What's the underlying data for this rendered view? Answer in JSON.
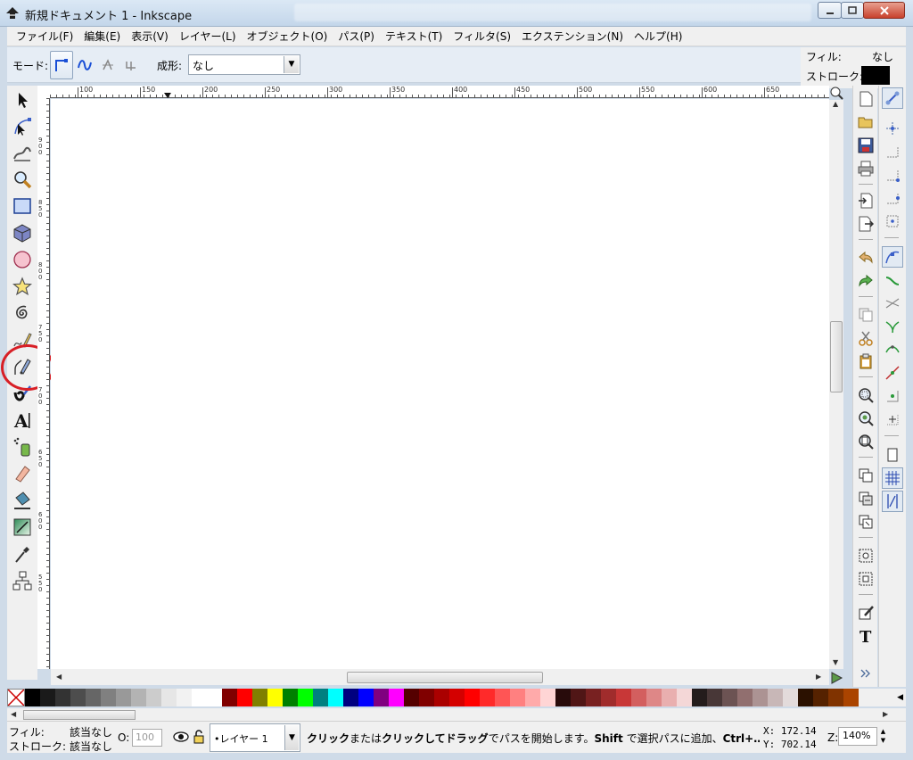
{
  "window": {
    "title": "新規ドキュメント 1 - Inkscape"
  },
  "menu": [
    "ファイル(F)",
    "編集(E)",
    "表示(V)",
    "レイヤー(L)",
    "オブジェクト(O)",
    "パス(P)",
    "テキスト(T)",
    "フィルタ(S)",
    "エクステンション(N)",
    "ヘルプ(H)"
  ],
  "tool_controls": {
    "mode_label": "モード:",
    "shape_label": "成形:",
    "shape_value": "なし"
  },
  "fill_stroke": {
    "fill_label": "フィル:",
    "fill_value": "なし",
    "stroke_label": "ストローク:",
    "stroke_color": "#000000"
  },
  "ruler": {
    "top_labels": [
      "100",
      "150",
      "200",
      "250",
      "300",
      "350",
      "400",
      "450",
      "500",
      "550",
      "600",
      "650"
    ],
    "left_labels": [
      "900",
      "850",
      "800",
      "750",
      "700",
      "650",
      "600",
      "550"
    ]
  },
  "palette": [
    "#000000",
    "#1a1a1a",
    "#333333",
    "#4d4d4d",
    "#666666",
    "#808080",
    "#999999",
    "#b3b3b3",
    "#cccccc",
    "#e6e6e6",
    "#f2f2f2",
    "#ffffff",
    "#ffffff",
    "#800000",
    "#ff0000",
    "#808000",
    "#ffff00",
    "#008000",
    "#00ff00",
    "#008080",
    "#00ffff",
    "#000080",
    "#0000ff",
    "#800080",
    "#ff00ff",
    "#550000",
    "#800000",
    "#aa0000",
    "#d40000",
    "#ff0000",
    "#ff2a2a",
    "#ff5555",
    "#ff8080",
    "#ffaaaa",
    "#ffd5d5",
    "#280b0b",
    "#501616",
    "#782121",
    "#a02c2c",
    "#c83737",
    "#d35f5f",
    "#de8787",
    "#e9afaf",
    "#f4d7d7",
    "#241c1c",
    "#483737",
    "#6c5353",
    "#916f6f",
    "#ac9393",
    "#c8b7b7",
    "#e3dbdb",
    "#2b1100",
    "#552200",
    "#803300",
    "#aa4400"
  ],
  "status": {
    "fill_label": "フィル:",
    "fill_value": "該当なし",
    "stroke_label": "ストローク:",
    "stroke_value": "該当なし",
    "opacity_label": "O:",
    "opacity_value": "100",
    "layer": "•レイヤー 1",
    "message_bold1": "クリック",
    "message_t1": "または",
    "message_bold2": "クリックしてドラッグ",
    "message_t2": "でパスを開始します。",
    "message_bold3": "Shift",
    "message_t3": " で選択パスに追加、",
    "message_bold4": "Ctrl+…",
    "x_label": "X:",
    "x_value": "172.14",
    "y_label": "Y:",
    "y_value": "702.14",
    "zoom_label": "Z:",
    "zoom_value": "140%"
  },
  "colors": {
    "highlight_circle": "#d81f26",
    "chrome": "#f0f0f0"
  },
  "icons": {
    "toolbox": [
      "selector-arrow-icon",
      "node-editor-icon",
      "tweak-icon",
      "zoom-icon",
      "rectangle-icon",
      "3d-box-icon",
      "ellipse-icon",
      "star-icon",
      "spiral-icon",
      "pencil-icon",
      "bezier-pen-icon",
      "calligraphy-icon",
      "text-icon",
      "spray-icon",
      "eraser-icon",
      "paint-bucket-icon",
      "gradient-icon",
      "dropper-icon",
      "connector-icon"
    ]
  }
}
